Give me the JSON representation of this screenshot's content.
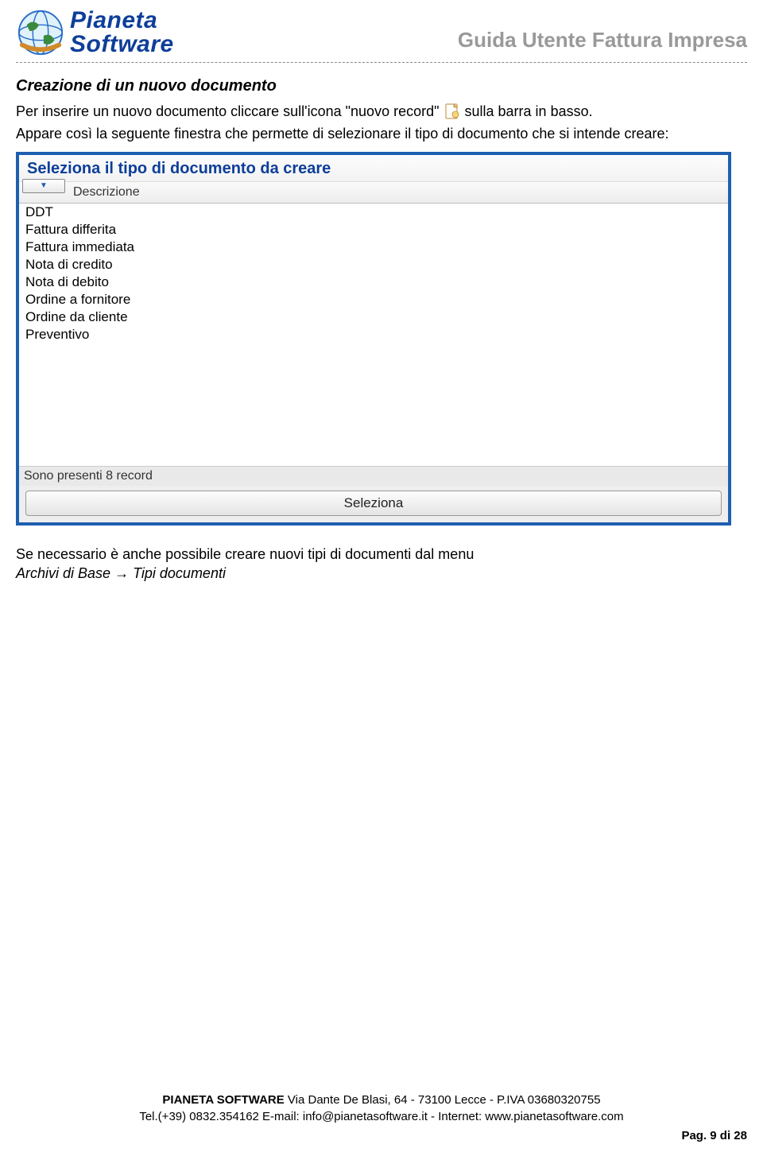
{
  "header": {
    "logo_line1": "Pianeta",
    "logo_line2": "Software",
    "doc_title": "Guida Utente Fattura Impresa"
  },
  "content": {
    "section_title": "Creazione di un nuovo documento",
    "para1_a": "Per inserire un nuovo documento cliccare sull'icona \"nuovo record\" ",
    "para1_b": " sulla barra in basso.",
    "para2": "Appare così la seguente finestra che permette di selezionare il tipo di documento che si intende creare:"
  },
  "app_window": {
    "title": "Seleziona il tipo di documento da creare",
    "column_header": "Descrizione",
    "rows": [
      "DDT",
      "Fattura differita",
      "Fattura immediata",
      "Nota di credito",
      "Nota di debito",
      "Ordine a fornitore",
      "Ordine da cliente",
      "Preventivo"
    ],
    "status": "Sono presenti 8 record",
    "select_button": "Seleziona"
  },
  "note": {
    "line1": "Se necessario è anche possibile creare nuovi tipi di documenti dal menu",
    "line2_a": "Archivi di Base ",
    "line2_arrow": "→",
    "line2_b": " Tipi documenti"
  },
  "footer": {
    "company": "PIANETA SOFTWARE",
    "addr": " Via Dante De Blasi, 64 - 73100 Lecce - P.IVA 03680320755",
    "line2": "Tel.(+39) 0832.354162  E-mail: info@pianetasoftware.it - Internet: www.pianetasoftware.com",
    "page": "Pag. 9 di 28"
  }
}
